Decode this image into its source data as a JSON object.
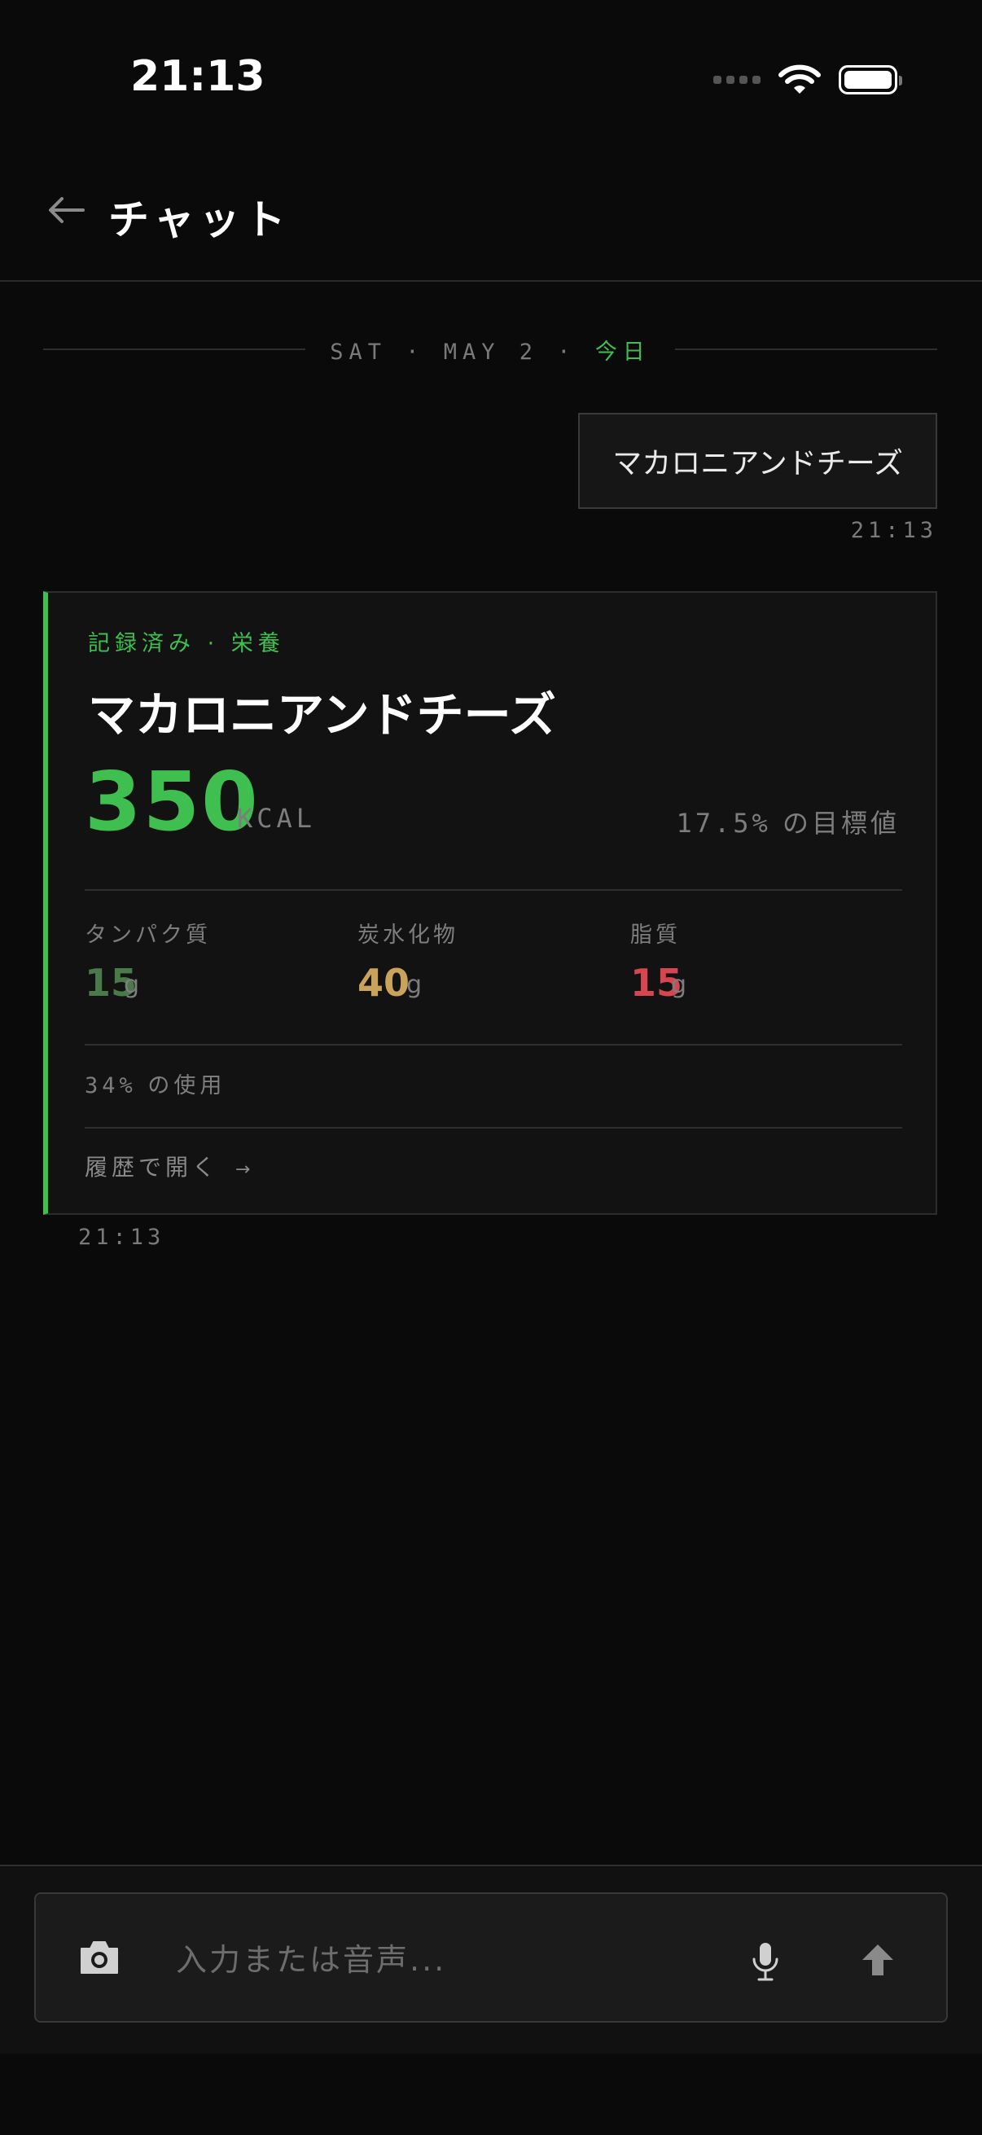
{
  "status_bar": {
    "time": "21:13"
  },
  "header": {
    "title": "チャット",
    "back_icon": "arrow-left-icon"
  },
  "date_separator": {
    "day": "SAT",
    "date": "MAY 2",
    "today": "今日"
  },
  "messages": {
    "user": {
      "text": "マカロニアンドチーズ",
      "time": "21:13"
    },
    "card": {
      "tag": "記録済み",
      "category": "栄養",
      "title": "マカロニアンドチーズ",
      "kcal": "350",
      "kcal_unit": "KCAL",
      "goal_percent": "17.5%",
      "goal_label": "の目標値",
      "macros": [
        {
          "label": "タンパク質",
          "value": "15",
          "unit": "g",
          "color": "#4a7a4a"
        },
        {
          "label": "炭水化物",
          "value": "40",
          "unit": "g",
          "color": "#c9a35a"
        },
        {
          "label": "脂質",
          "value": "15",
          "unit": "g",
          "color": "#d64550"
        }
      ],
      "usage_percent": "34%",
      "usage_label": "の使用",
      "open_history": "履歴で開く",
      "open_history_arrow": "→",
      "time": "21:13",
      "accent_color": "#3fbf4f"
    }
  },
  "input": {
    "placeholder": "入力または音声...",
    "camera_icon": "camera-icon",
    "mic_icon": "microphone-icon",
    "send_icon": "arrow-up-icon"
  }
}
